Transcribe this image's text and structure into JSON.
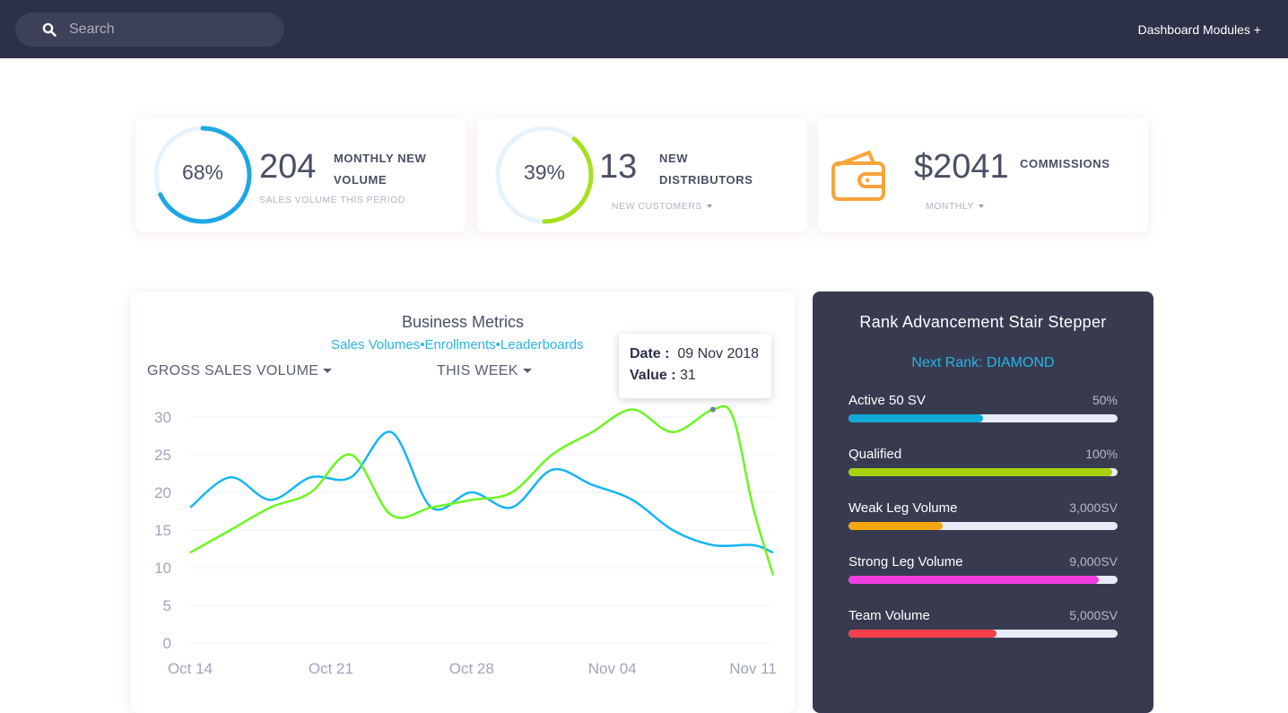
{
  "topbar": {
    "search_placeholder": "Search",
    "modules_label": "Dashboard Modules +"
  },
  "stats": {
    "volume": {
      "percent": "68%",
      "percent_value": 68,
      "number": "204",
      "label_line1": "MONTHLY NEW",
      "label_line2": "VOLUME",
      "sub": "SALES VOLUME THIS PERIOD",
      "ring_color": "#1ea7e4"
    },
    "distributors": {
      "percent": "39%",
      "percent_value": 39,
      "number": "13",
      "label_line1": "NEW",
      "label_line2": "DISTRIBUTORS",
      "dropdown": "NEW CUSTOMERS",
      "ring_color": "#a6e01f"
    },
    "commissions": {
      "number": "$2041",
      "label": "COMMISSIONS",
      "dropdown": "MONTHLY",
      "icon": "wallet-icon",
      "icon_color": "#f7a43a"
    }
  },
  "metrics": {
    "title": "Business Metrics",
    "subtitle": "Sales Volumes•Enrollments•Leaderboards",
    "metric_dropdown": "GROSS SALES VOLUME",
    "period_dropdown": "THIS WEEK",
    "tooltip": {
      "date_label": "Date :",
      "date_value": "09 Nov 2018",
      "value_label": "Value :",
      "value_value": "31"
    }
  },
  "chart_data": {
    "type": "line",
    "x_ticks": [
      "Oct 14",
      "Oct 21",
      "Oct 28",
      "Nov 04",
      "Nov 11"
    ],
    "y_ticks": [
      "0",
      "5",
      "10",
      "15",
      "20",
      "25",
      "30"
    ],
    "ylim": [
      0,
      30
    ],
    "grid": true,
    "series": [
      {
        "color": "#16b5f2",
        "x": [
          "2018-10-14",
          "2018-10-16",
          "2018-10-18",
          "2018-10-20",
          "2018-10-22",
          "2018-10-24",
          "2018-10-26",
          "2018-10-28",
          "2018-10-30",
          "2018-11-01",
          "2018-11-03",
          "2018-11-05",
          "2018-11-07",
          "2018-11-09",
          "2018-11-11",
          "2018-11-12"
        ],
        "values": [
          18,
          22,
          19,
          22,
          22,
          28,
          18,
          20,
          18,
          23,
          21,
          19,
          15,
          13,
          13,
          12
        ]
      },
      {
        "color": "#6cf520",
        "x": [
          "2018-10-14",
          "2018-10-16",
          "2018-10-18",
          "2018-10-20",
          "2018-10-22",
          "2018-10-24",
          "2018-10-26",
          "2018-10-28",
          "2018-10-30",
          "2018-11-01",
          "2018-11-03",
          "2018-11-05",
          "2018-11-07",
          "2018-11-09",
          "2018-11-10",
          "2018-11-11",
          "2018-11-12"
        ],
        "values": [
          12,
          15,
          18,
          20,
          25,
          17,
          18,
          19,
          20,
          25,
          28,
          31,
          28,
          31,
          30,
          18,
          9
        ]
      }
    ]
  },
  "rank": {
    "title": "Rank Advancement Stair Stepper",
    "next_rank": "Next Rank: DIAMOND",
    "items": [
      {
        "label": "Active 50 SV",
        "value": "50%",
        "fill": 0.5,
        "color": "#12a9d6"
      },
      {
        "label": "Qualified",
        "value": "100%",
        "fill": 0.98,
        "color": "#a5d10f"
      },
      {
        "label": "Weak Leg Volume",
        "value": "3,000SV",
        "fill": 0.35,
        "color": "#f5a70f"
      },
      {
        "label": "Strong Leg Volume",
        "value": "9,000SV",
        "fill": 0.93,
        "color": "#f03de0"
      },
      {
        "label": "Team Volume",
        "value": "5,000SV",
        "fill": 0.55,
        "color": "#f5404d"
      }
    ]
  }
}
